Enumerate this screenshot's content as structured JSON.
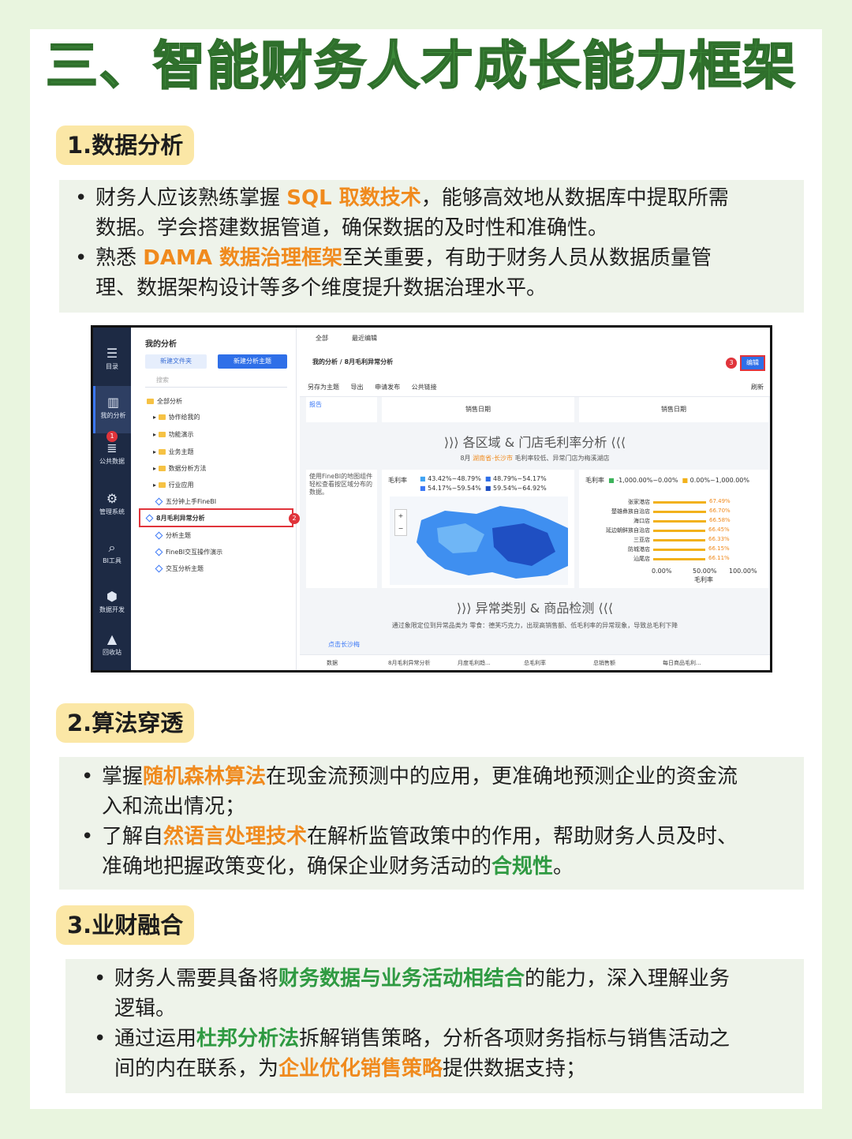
{
  "title": "三、智能财务人才成长能力框架",
  "sections": [
    {
      "label": "1.数据分析",
      "bullets": [
        {
          "line1_a": "财务人应该熟练掌握 ",
          "line1_h": "SQL 取数技术",
          "line1_b": "，能够高效地从数据库中提取所需",
          "line2": "数据。学会搭建数据管道，确保数据的及时性和准确性。"
        },
        {
          "line1_a": "熟悉 ",
          "line1_h": "DAMA 数据治理框架",
          "line1_b": "至关重要，有助于财务人员从数据质量管",
          "line2": "理、数据架构设计等多个维度提升数据治理水平。"
        }
      ]
    },
    {
      "label": "2.算法穿透",
      "bullets": [
        {
          "line1_a": "掌握",
          "line1_h": "随机森林算法",
          "line1_b": "在现金流预测中的应用，更准确地预测企业的资金流",
          "line2": "入和流出情况；"
        },
        {
          "line1_a": "了解自",
          "line1_h": "然语言处理技术",
          "line1_b": "在解析监管政策中的作用，帮助财务人员及时、",
          "line2_a": "准确地把握政策变化，确保企业财务活动的",
          "line2_h": "合规性",
          "line2_b": "。"
        }
      ]
    },
    {
      "label": "3.业财融合",
      "bullets": [
        {
          "line1_a": "财务人需要具备将",
          "line1_h": "财务数据与业务活动相结合",
          "line1_b": "的能力，深入理解业务",
          "line2": "逻辑。"
        },
        {
          "line1_a": "通过运用",
          "line1_h": "杜邦分析法",
          "line1_b": "拆解销售策略，分析各项财务指标与销售活动之",
          "line2_a": "间的内在联系，为",
          "line2_h": "企业优化销售策略",
          "line2_b": "提供数据支持；"
        }
      ]
    }
  ],
  "screenshot": {
    "rail": [
      "目录",
      "我的分析",
      "公共数据",
      "管理系统",
      "BI工具",
      "数据开发",
      "回收站"
    ],
    "rail_icons": [
      "list-icon",
      "chart-icon",
      "database-icon",
      "gear-icon",
      "magnifier-icon",
      "cube-icon",
      "recycle-icon"
    ],
    "tree_header": "我的分析",
    "btn_new_folder": "新建文件夹",
    "btn_new_topic": "新建分析主题",
    "search_placeholder": "搜索",
    "tree_items": [
      "全部分析",
      "协作给我的",
      "功能演示",
      "业务主题",
      "数据分析方法",
      "行业应用",
      "五分钟上手FineBI",
      "8月毛利异常分析",
      "分析主题",
      "FineBI交互操作演示",
      "交互分析主题"
    ],
    "tabs": [
      "全部",
      "最近编辑"
    ],
    "breadcrumb_root": "我的分析",
    "breadcrumb_sep": "/",
    "breadcrumb_current": "8月毛利异常分析",
    "edit_label": "编辑",
    "toolbar": [
      "另存为主题",
      "导出",
      "申请发布",
      "公共链接"
    ],
    "refresh": "刷新",
    "badges": [
      "1",
      "2",
      "3"
    ],
    "report_tag": "报告",
    "sales_date": "销售日期",
    "section1_title": "各区域 & 门店毛利率分析",
    "section1_sub_a": "8月 ",
    "section1_sub_h": "湖南省-长沙市",
    "section1_sub_b": " 毛利率较低、异常门店为梅溪湖店",
    "map_note": "使用FineBI的地图组件轻松查看按区域分布的数据。",
    "legend_label": "毛利率",
    "map_legend": [
      "43.42%~48.79%",
      "48.79%~54.17%",
      "54.17%~59.54%",
      "59.54%~64.92%"
    ],
    "bar_legend": [
      "-1,000.00%~0.00%",
      "0.00%~1,000.00%"
    ],
    "stores": [
      "张家港店",
      "楚雄彝族自治店",
      "海口店",
      "延边朝鲜族自治店",
      "三亚店",
      "防城港店",
      "汕尾店"
    ],
    "store_values": [
      "67.49%",
      "66.70%",
      "66.58%",
      "66.45%",
      "66.33%",
      "66.15%",
      "66.11%"
    ],
    "x_ticks": [
      "0.00%",
      "50.00%",
      "100.00%"
    ],
    "x_label": "毛利率",
    "section2_title": "异常类别 & 商品检测",
    "section2_sub": "通过象限定位到异常品类为 零食：德芙巧克力，出现高销售额、低毛利率的异常现象，导致总毛利下降",
    "click_hint": "点击长沙梅",
    "bottom_tabs": [
      "数据",
      "8月毛利异常分析",
      "月度毛利趋...",
      "总毛利率",
      "总销售额",
      "每日商品毛利..."
    ]
  }
}
